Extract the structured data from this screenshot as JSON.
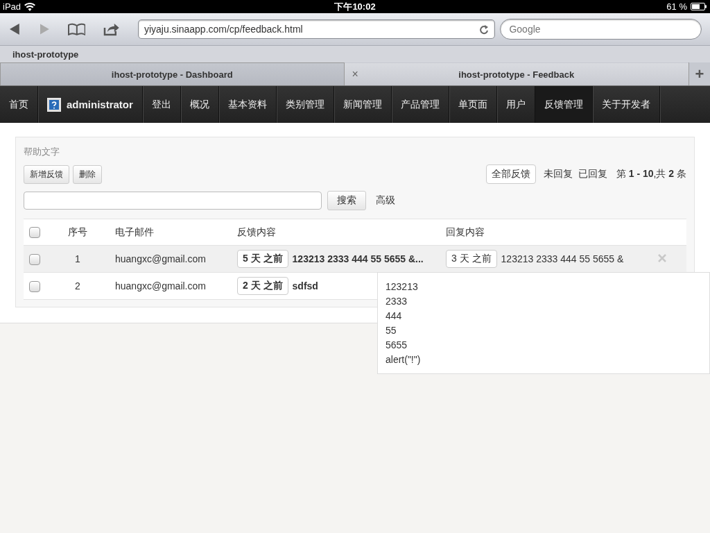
{
  "status_bar": {
    "device": "iPad",
    "time": "下午10:02",
    "battery": "61 %"
  },
  "browser": {
    "url": "yiyaju.sinaapp.com/cp/feedback.html",
    "search": {
      "placeholder": "Google"
    },
    "bookmarks": [
      "ihost-prototype"
    ],
    "tabs": [
      {
        "title": "ihost-prototype - Dashboard",
        "selected": false
      },
      {
        "title": "ihost-prototype - Feedback",
        "selected": true
      }
    ],
    "close_tab": "×",
    "new_tab": "+"
  },
  "nav": [
    {
      "label": "首页",
      "kind": "link",
      "selected": false
    },
    {
      "label": "administrator",
      "kind": "user",
      "selected": false
    },
    {
      "label": "登出",
      "kind": "link",
      "selected": false
    },
    {
      "label": "概况",
      "kind": "link",
      "selected": false
    },
    {
      "label": "基本资料",
      "kind": "link",
      "selected": false
    },
    {
      "label": "类别管理",
      "kind": "link",
      "selected": false
    },
    {
      "label": "新闻管理",
      "kind": "link",
      "selected": false
    },
    {
      "label": "产品管理",
      "kind": "link",
      "selected": false
    },
    {
      "label": "单页面",
      "kind": "link",
      "selected": false
    },
    {
      "label": "用户",
      "kind": "link",
      "selected": false
    },
    {
      "label": "反馈管理",
      "kind": "link",
      "selected": true
    },
    {
      "label": "关于开发者",
      "kind": "link",
      "selected": false
    }
  ],
  "panel": {
    "help": "帮助文字",
    "actions": [
      "新增反馈",
      "删除"
    ],
    "filters": [
      {
        "label": "全部反馈",
        "selected": true
      },
      {
        "label": "未回复",
        "selected": false
      },
      {
        "label": "已回复",
        "selected": false
      }
    ],
    "pagination": "第 **1 - 10**,共 **2** 条",
    "search_button": "搜索",
    "advanced": "高级",
    "table": {
      "header_checked": false,
      "columns": [
        "序号",
        "电子邮件",
        "反馈内容",
        "回复内容"
      ],
      "rows": [
        {
          "checked": false,
          "hovered": true,
          "index": "1",
          "email": "huangxc@gmail.com",
          "feedback_age": "5 天 之前",
          "feedback": "123213 2333 444 55 5655 &...",
          "reply_age": "3 天 之前",
          "reply": "123213 2333 444 55 5655 &"
        },
        {
          "checked": false,
          "hovered": false,
          "index": "2",
          "email": "huangxc@gmail.com",
          "feedback_age": "2 天 之前",
          "feedback": "sdfsd"
        }
      ]
    }
  },
  "popover": {
    "lines": [
      "123213",
      "2333",
      "444",
      "55",
      "5655",
      "alert(\"!\")"
    ]
  }
}
